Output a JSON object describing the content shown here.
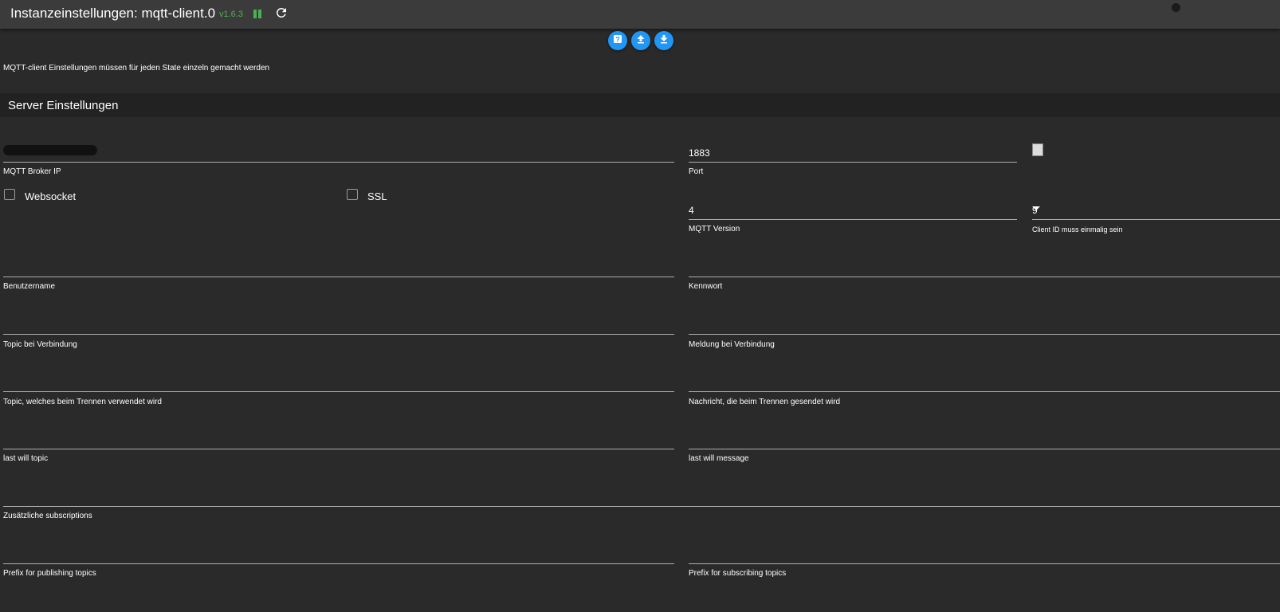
{
  "header": {
    "title": "Instanzeinstellungen: mqtt-client.0",
    "version": "v1.6.3"
  },
  "icons": {
    "help": "help-icon",
    "upload": "upload-icon",
    "download": "download-icon",
    "pause": "pause-icon",
    "reload": "reload-icon"
  },
  "colors": {
    "background": "#2a2a2a",
    "header": "#3b3b3b",
    "accent": "#2196f3",
    "running": "#4caf50"
  },
  "note": "MQTT-client Einstellungen müssen für jeden State einzeln gemacht werden",
  "section": {
    "title": "Server Einstellungen"
  },
  "fields": {
    "broker_ip": {
      "label": "MQTT Broker IP",
      "value": ""
    },
    "port": {
      "label": "Port",
      "value": "1883"
    },
    "websocket": {
      "label": "Websocket",
      "checked": false
    },
    "ssl": {
      "label": "SSL",
      "checked": false
    },
    "mqtt_version": {
      "label": "MQTT Version",
      "value": "4"
    },
    "client_id": {
      "label": "Client ID muss einmalig sein",
      "value": "9"
    },
    "username": {
      "label": "Benutzername",
      "value": ""
    },
    "password": {
      "label": "Kennwort",
      "value": ""
    },
    "connect_topic": {
      "label": "Topic bei Verbindung",
      "value": ""
    },
    "connect_message": {
      "label": "Meldung bei Verbindung",
      "value": ""
    },
    "disconnect_topic": {
      "label": "Topic, welches beim Trennen verwendet wird",
      "value": ""
    },
    "disconnect_message": {
      "label": "Nachricht, die beim Trennen gesendet wird",
      "value": ""
    },
    "last_will_topic": {
      "label": "last will topic",
      "value": ""
    },
    "last_will_message": {
      "label": "last will message",
      "value": ""
    },
    "subscriptions": {
      "label": "Zusätzliche subscriptions",
      "value": ""
    },
    "publish_prefix": {
      "label": "Prefix for publishing topics",
      "value": ""
    },
    "subscribe_prefix": {
      "label": "Prefix for subscribing topics",
      "value": ""
    }
  }
}
